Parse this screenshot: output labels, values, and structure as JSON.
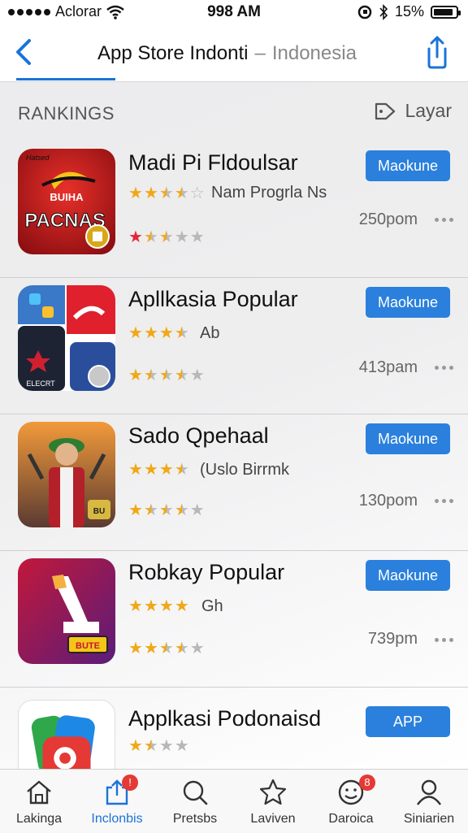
{
  "status_bar": {
    "carrier": "Aclorar",
    "time": "998 AM",
    "battery": "15%",
    "battery_level": 0.9
  },
  "nav": {
    "title": "App Store Indonti",
    "separator": "–",
    "subtitle": "Indonesia"
  },
  "section": {
    "title": "RANKINGS",
    "sort_label": "Layar"
  },
  "apps": [
    {
      "name": "Madi Pi Fldoulsar",
      "subtitle": "Nam Progrla Ns",
      "button": "Maokune",
      "time": "250pom",
      "icon_text_top": "Hatsed",
      "icon_text_mid": "BUIHA",
      "icon_text": "PACNAS"
    },
    {
      "name": "Apllkasia Popular",
      "subtitle": "Ab",
      "button": "Maokune",
      "time": "413pam",
      "icon_text": "ELECRT"
    },
    {
      "name": "Sado Qpehaal",
      "subtitle": "(Uslo Birrmk",
      "button": "Maokune",
      "time": "130pom",
      "icon_text": "BU"
    },
    {
      "name": "Robkay Popular",
      "subtitle": "Gh",
      "button": "Maokune",
      "time": "739pm",
      "icon_text": "BUTE"
    },
    {
      "name": "Applkasi Podonaisd",
      "subtitle": "",
      "button": "APP",
      "time": ""
    }
  ],
  "tabs": [
    {
      "label": "Lakinga",
      "icon": "home-icon"
    },
    {
      "label": "Inclonbis",
      "icon": "share-box-icon",
      "badge": "!"
    },
    {
      "label": "Pretsbs",
      "icon": "search-icon"
    },
    {
      "label": "Laviven",
      "icon": "star-icon"
    },
    {
      "label": "Daroica",
      "icon": "face-icon",
      "badge": "8"
    },
    {
      "label": "Siniarien",
      "icon": "person-icon"
    }
  ],
  "colors": {
    "accent": "#1a73d9",
    "button": "#2a80dc",
    "star": "#f0a818",
    "badge": "#e53935"
  }
}
